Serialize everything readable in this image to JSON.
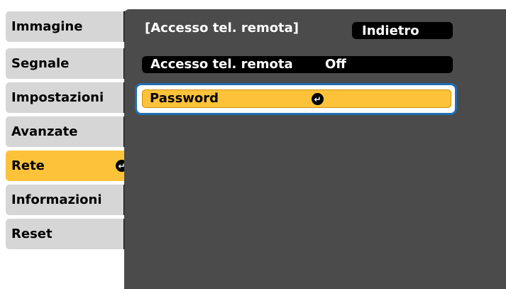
{
  "sidebar": {
    "items": [
      {
        "label": "Immagine"
      },
      {
        "label": "Segnale"
      },
      {
        "label": "Impostazioni"
      },
      {
        "label": "Avanzate"
      },
      {
        "label": "Rete",
        "active": true
      },
      {
        "label": "Informazioni"
      },
      {
        "label": "Reset"
      }
    ],
    "active_enter_icon": "↵"
  },
  "panel": {
    "title": "[Accesso tel. remota]",
    "back_label": "Indietro",
    "setting": {
      "label": "Accesso tel. remota",
      "value": "Off"
    },
    "password": {
      "label": "Password",
      "enter_icon": "↵"
    }
  },
  "colors": {
    "panel_bg": "#4b4b4b",
    "highlight": "#fcc33a",
    "focus_ring": "#1f6fb5",
    "sidebar_item_bg": "#d6d6d6"
  }
}
